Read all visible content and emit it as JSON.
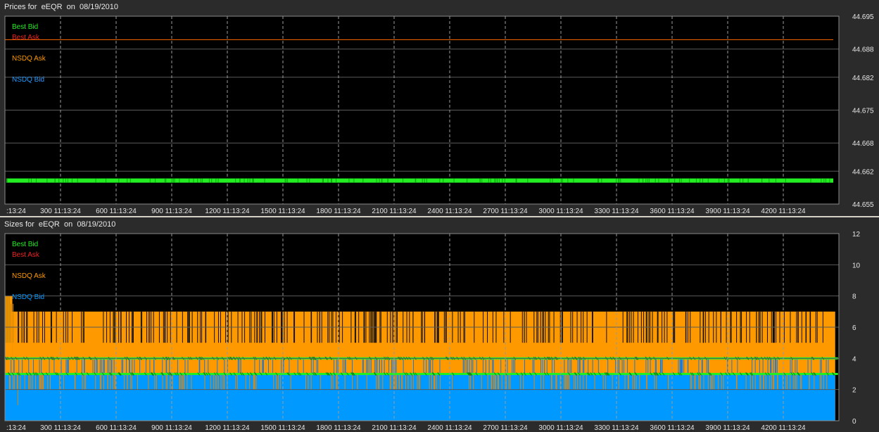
{
  "chart_data": [
    {
      "type": "line",
      "title": "Prices for  eEQR  on  08/19/2010",
      "xlabel": "",
      "ylabel": "",
      "x_tick_labels": [
        ":13:24",
        "300 11:13:24",
        "600 11:13:24",
        "900 11:13:24",
        "1200 11:13:24",
        "1500 11:13:24",
        "1800 11:13:24",
        "2100 11:13:24",
        "2400 11:13:24",
        "2700 11:13:24",
        "3000 11:13:24",
        "3300 11:13:24",
        "3600 11:13:24",
        "3900 11:13:24",
        "4200 11:13:24"
      ],
      "x_tick_values": [
        0,
        300,
        600,
        900,
        1200,
        1500,
        1800,
        2100,
        2400,
        2700,
        3000,
        3300,
        3600,
        3900,
        4200
      ],
      "xlim": [
        0,
        4500
      ],
      "y_tick_labels": [
        "44.695",
        "44.688",
        "44.682",
        "44.675",
        "44.668",
        "44.662",
        "44.655"
      ],
      "y_tick_values": [
        44.695,
        44.688,
        44.682,
        44.675,
        44.668,
        44.662,
        44.655
      ],
      "ylim": [
        44.655,
        44.695
      ],
      "grid": true,
      "legend_position": "top-left",
      "series": [
        {
          "name": "Best Bid",
          "color": "#22ee22",
          "value": 44.66,
          "style": "markers"
        },
        {
          "name": "Best Ask",
          "color": "#ee2222",
          "value": 44.69,
          "style": "line"
        },
        {
          "name": "NSDQ Ask",
          "color": "#ff9900",
          "value": 44.69,
          "style": "line"
        },
        {
          "name": "NSDQ Bid",
          "color": "#2299ff",
          "value": 44.66,
          "style": "line"
        }
      ]
    },
    {
      "type": "area",
      "title": "Sizes for  eEQR  on  08/19/2010",
      "xlabel": "",
      "ylabel": "",
      "x_tick_labels": [
        ":13:24",
        "300 11:13:24",
        "600 11:13:24",
        "900 11:13:24",
        "1200 11:13:24",
        "1500 11:13:24",
        "1800 11:13:24",
        "2100 11:13:24",
        "2400 11:13:24",
        "2700 11:13:24",
        "3000 11:13:24",
        "3300 11:13:24",
        "3600 11:13:24",
        "3900 11:13:24",
        "4200 11:13:24"
      ],
      "x_tick_values": [
        0,
        300,
        600,
        900,
        1200,
        1500,
        1800,
        2100,
        2400,
        2700,
        3000,
        3300,
        3600,
        3900,
        4200
      ],
      "xlim": [
        0,
        4500
      ],
      "y_tick_labels": [
        "12",
        "10",
        "8",
        "6",
        "4",
        "2",
        "0"
      ],
      "y_tick_values": [
        12,
        10,
        8,
        6,
        4,
        2,
        0
      ],
      "ylim": [
        0,
        12
      ],
      "grid": true,
      "legend_position": "top-left",
      "series": [
        {
          "name": "Best Bid",
          "color": "#22ee22",
          "values_by_segment": [
            [
              0,
              4500,
              4
            ]
          ],
          "secondary_level": 3,
          "style": "markers"
        },
        {
          "name": "Best Ask",
          "color": "#ee2222",
          "values_by_segment": [],
          "style": "line"
        },
        {
          "name": "NSDQ Ask",
          "color": "#ff9900",
          "values_by_segment": [
            [
              0,
              40,
              8
            ],
            [
              40,
              4500,
              7
            ]
          ],
          "dip_level": 5,
          "style": "area"
        },
        {
          "name": "NSDQ Bid",
          "color": "#0099ff",
          "values_by_segment": [
            [
              0,
              4500,
              3
            ]
          ],
          "dip_level": 2,
          "style": "area"
        }
      ]
    }
  ]
}
